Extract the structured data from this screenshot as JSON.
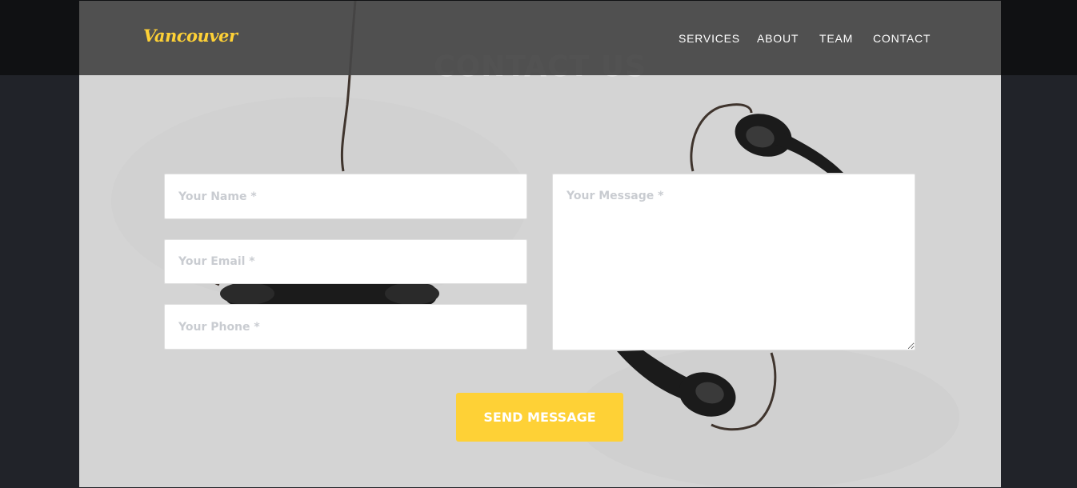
{
  "brand": {
    "name": "Vancouver"
  },
  "nav": {
    "items": [
      "SERVICES",
      "ABOUT",
      "TEAM",
      "CONTACT"
    ]
  },
  "contact": {
    "title": "CONTACT US",
    "name_placeholder": "Your Name *",
    "email_placeholder": "Your Email *",
    "phone_placeholder": "Your Phone *",
    "message_placeholder": "Your Message *",
    "submit_label": "SEND MESSAGE"
  },
  "colors": {
    "accent": "#fed136",
    "page_background": "#212329",
    "section_background": "#d4d4d4",
    "navbar": "#464646"
  },
  "background_image": {
    "icon": "vintage-telephone-handsets"
  }
}
